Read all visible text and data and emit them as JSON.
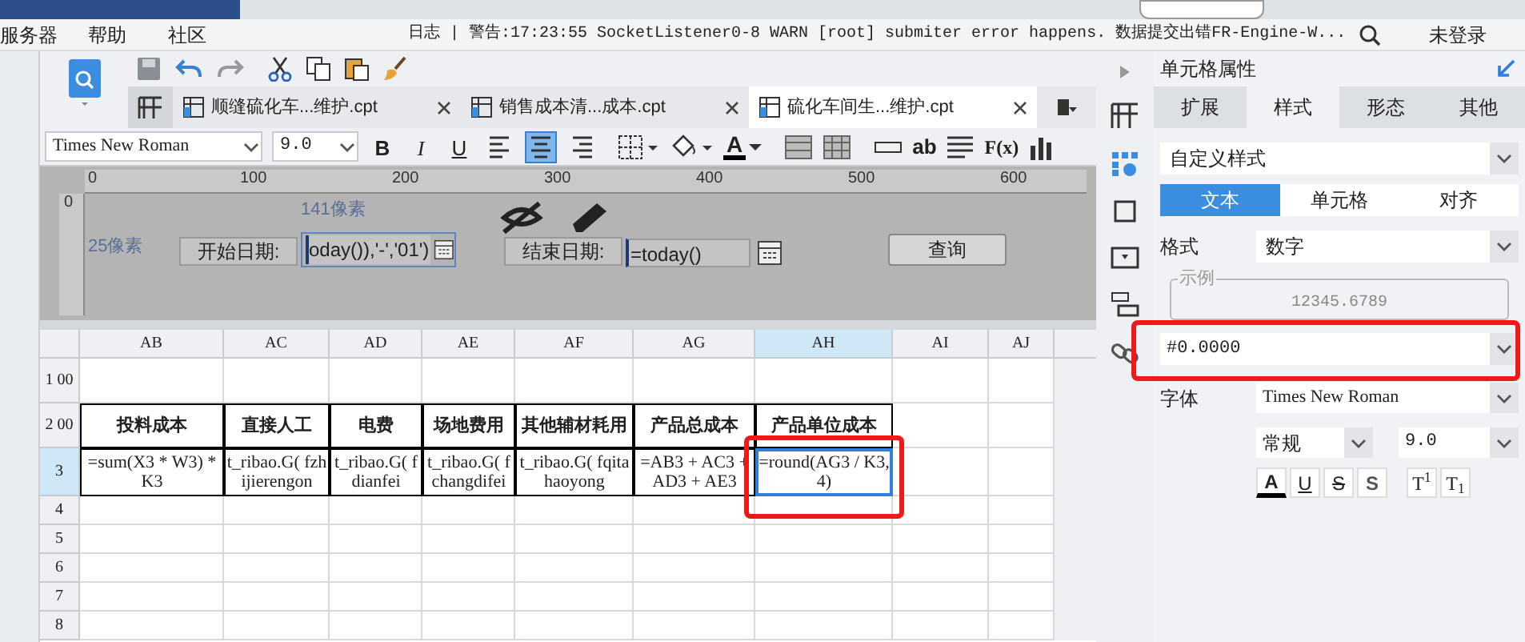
{
  "menu_bar": {
    "items": [
      "服务器",
      "帮助",
      "社区"
    ],
    "log": "日志 | 警告:17:23:55 SocketListener0-8 WARN [root] submiter error happens. 数据提交出错FR-Engine-W...",
    "login": "未登录"
  },
  "file_tabs": [
    {
      "label": "顺缝硫化车...维护.cpt",
      "selected": false
    },
    {
      "label": "销售成本清...成本.cpt",
      "selected": false
    },
    {
      "label": "硫化车间生...维护.cpt",
      "selected": true
    }
  ],
  "format_toolbar": {
    "font": "Times New Roman",
    "size": "9.0",
    "style_buttons": [
      "B",
      "I",
      "U"
    ],
    "align": [
      {
        "kind": "left",
        "selected": false
      },
      {
        "kind": "center",
        "selected": true
      },
      {
        "kind": "right",
        "selected": false
      }
    ],
    "font_color": "A",
    "text_tool": "ab",
    "formula_tool": "F(x)"
  },
  "parameter_panel": {
    "ruler_ticks": [
      "0",
      "100",
      "200",
      "300",
      "400",
      "500",
      "600"
    ],
    "vertical_ruler": "0",
    "width_hint": "141像素",
    "height_hint": "25像素",
    "start_label": "开始日期:",
    "start_value": "oday()),'-','01')",
    "end_label": "结束日期:",
    "end_value": "=today()",
    "query_button": "查询"
  },
  "sheet": {
    "columns": [
      {
        "label": "AB",
        "selected": false
      },
      {
        "label": "AC",
        "selected": false
      },
      {
        "label": "AD",
        "selected": false
      },
      {
        "label": "AE",
        "selected": false
      },
      {
        "label": "AF",
        "selected": false
      },
      {
        "label": "AG",
        "selected": false
      },
      {
        "label": "AH",
        "selected": true
      },
      {
        "label": "AI",
        "selected": false
      },
      {
        "label": "AJ",
        "selected": false
      }
    ],
    "rows": [
      {
        "label": "1 00",
        "selected": false,
        "cells": []
      },
      {
        "label": "2 00",
        "selected": false,
        "cells": [
          {
            "text": "投料成本",
            "selected": false
          },
          {
            "text": "直接人工",
            "selected": false
          },
          {
            "text": "电费",
            "selected": false
          },
          {
            "text": "场地费用",
            "selected": false
          },
          {
            "text": "其他辅材耗用",
            "selected": false
          },
          {
            "text": "产品总成本",
            "selected": false
          },
          {
            "text": "产品单位成本",
            "selected": false
          }
        ]
      },
      {
        "label": "3",
        "selected": true,
        "cells": [
          {
            "text": "=sum(X3 * W3) * K3",
            "selected": false
          },
          {
            "text": "t_ribao.G( fzhijierengon",
            "selected": false
          },
          {
            "text": "t_ribao.G( fdianfei",
            "selected": false
          },
          {
            "text": "t_ribao.G( fchangdifei",
            "selected": false
          },
          {
            "text": "t_ribao.G( fqitahaoyong",
            "selected": false
          },
          {
            "text": "=AB3 + AC3 + AD3 + AE3",
            "selected": false
          },
          {
            "text": "=round(AG3 / K3,4)",
            "selected": true
          }
        ]
      },
      {
        "label": "4",
        "selected": false,
        "cells": []
      },
      {
        "label": "5",
        "selected": false,
        "cells": []
      },
      {
        "label": "6",
        "selected": false,
        "cells": []
      },
      {
        "label": "7",
        "selected": false,
        "cells": []
      },
      {
        "label": "8",
        "selected": false,
        "cells": []
      }
    ]
  },
  "property_panel": {
    "title": "单元格属性",
    "tabs": [
      {
        "label": "扩展",
        "selected": false
      },
      {
        "label": "样式",
        "selected": true
      },
      {
        "label": "形态",
        "selected": false
      },
      {
        "label": "其他",
        "selected": false
      }
    ],
    "style_select": "自定义样式",
    "sub_tabs": [
      {
        "label": "文本",
        "selected": true
      },
      {
        "label": "单元格",
        "selected": false
      },
      {
        "label": "对齐",
        "selected": false
      }
    ],
    "format_label": "格式",
    "format_value": "数字",
    "sample_legend": "示例",
    "sample_value": "12345.6789",
    "pattern_value": "#0.0000",
    "font_label": "字体",
    "font_value": "Times New Roman",
    "weight_value": "常规",
    "size_value": "9.0",
    "text_buttons": [
      {
        "label": "A",
        "kind": "color"
      },
      {
        "label": "U",
        "kind": "underline"
      },
      {
        "label": "S",
        "kind": "strike"
      },
      {
        "label": "S",
        "kind": "shadow"
      },
      {
        "label": "T$^{1}$",
        "kind": "super"
      },
      {
        "label": "T$_{1}$",
        "kind": "sub"
      }
    ]
  }
}
